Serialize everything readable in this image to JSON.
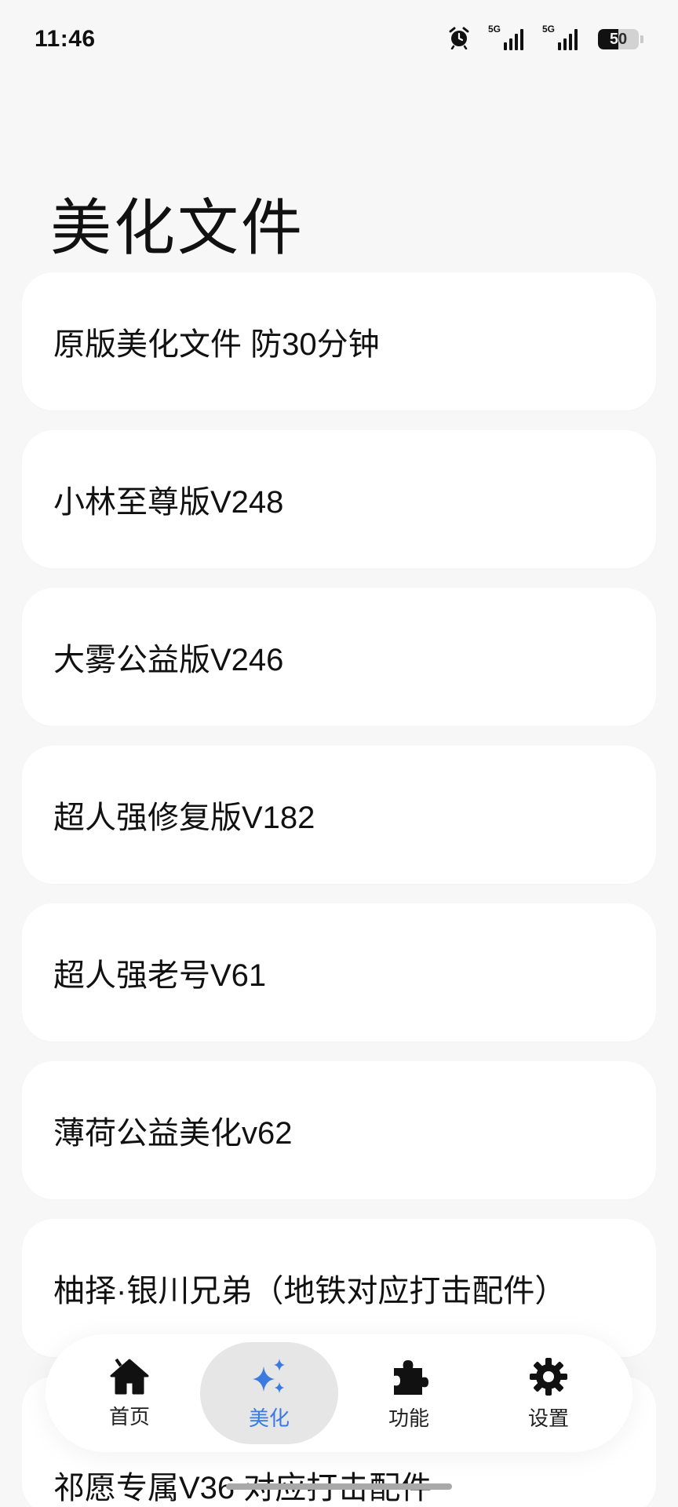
{
  "status_bar": {
    "time": "11:46",
    "signal1_label": "5G",
    "signal2_label": "5G",
    "battery": "50",
    "battery_level": 0.5,
    "icons": [
      "alarm-icon",
      "signal-5g-icon",
      "signal-5g-icon",
      "battery-icon"
    ]
  },
  "page": {
    "title": "美化文件"
  },
  "files": [
    {
      "label": "原版美化文件 防30分钟"
    },
    {
      "label": "小林至尊版V248"
    },
    {
      "label": "大雾公益版V246"
    },
    {
      "label": "超人强修复版V182"
    },
    {
      "label": "超人强老号V61"
    },
    {
      "label": "薄荷公益美化v62"
    },
    {
      "label": "柚择·银川兄弟（地铁对应打击配件）"
    },
    {
      "label": "祁愿专属V36 对应打击配件"
    }
  ],
  "nav": {
    "active": "beautify",
    "items": [
      {
        "id": "home",
        "label": "首页",
        "icon": "home-icon"
      },
      {
        "id": "beautify",
        "label": "美化",
        "icon": "sparkle-icon"
      },
      {
        "id": "features",
        "label": "功能",
        "icon": "puzzle-icon"
      },
      {
        "id": "settings",
        "label": "设置",
        "icon": "gear-icon"
      }
    ]
  },
  "colors": {
    "background": "#f7f7f7",
    "card": "#ffffff",
    "accent": "#3a7be0",
    "nav_active_bg": "#e6e6e6"
  }
}
